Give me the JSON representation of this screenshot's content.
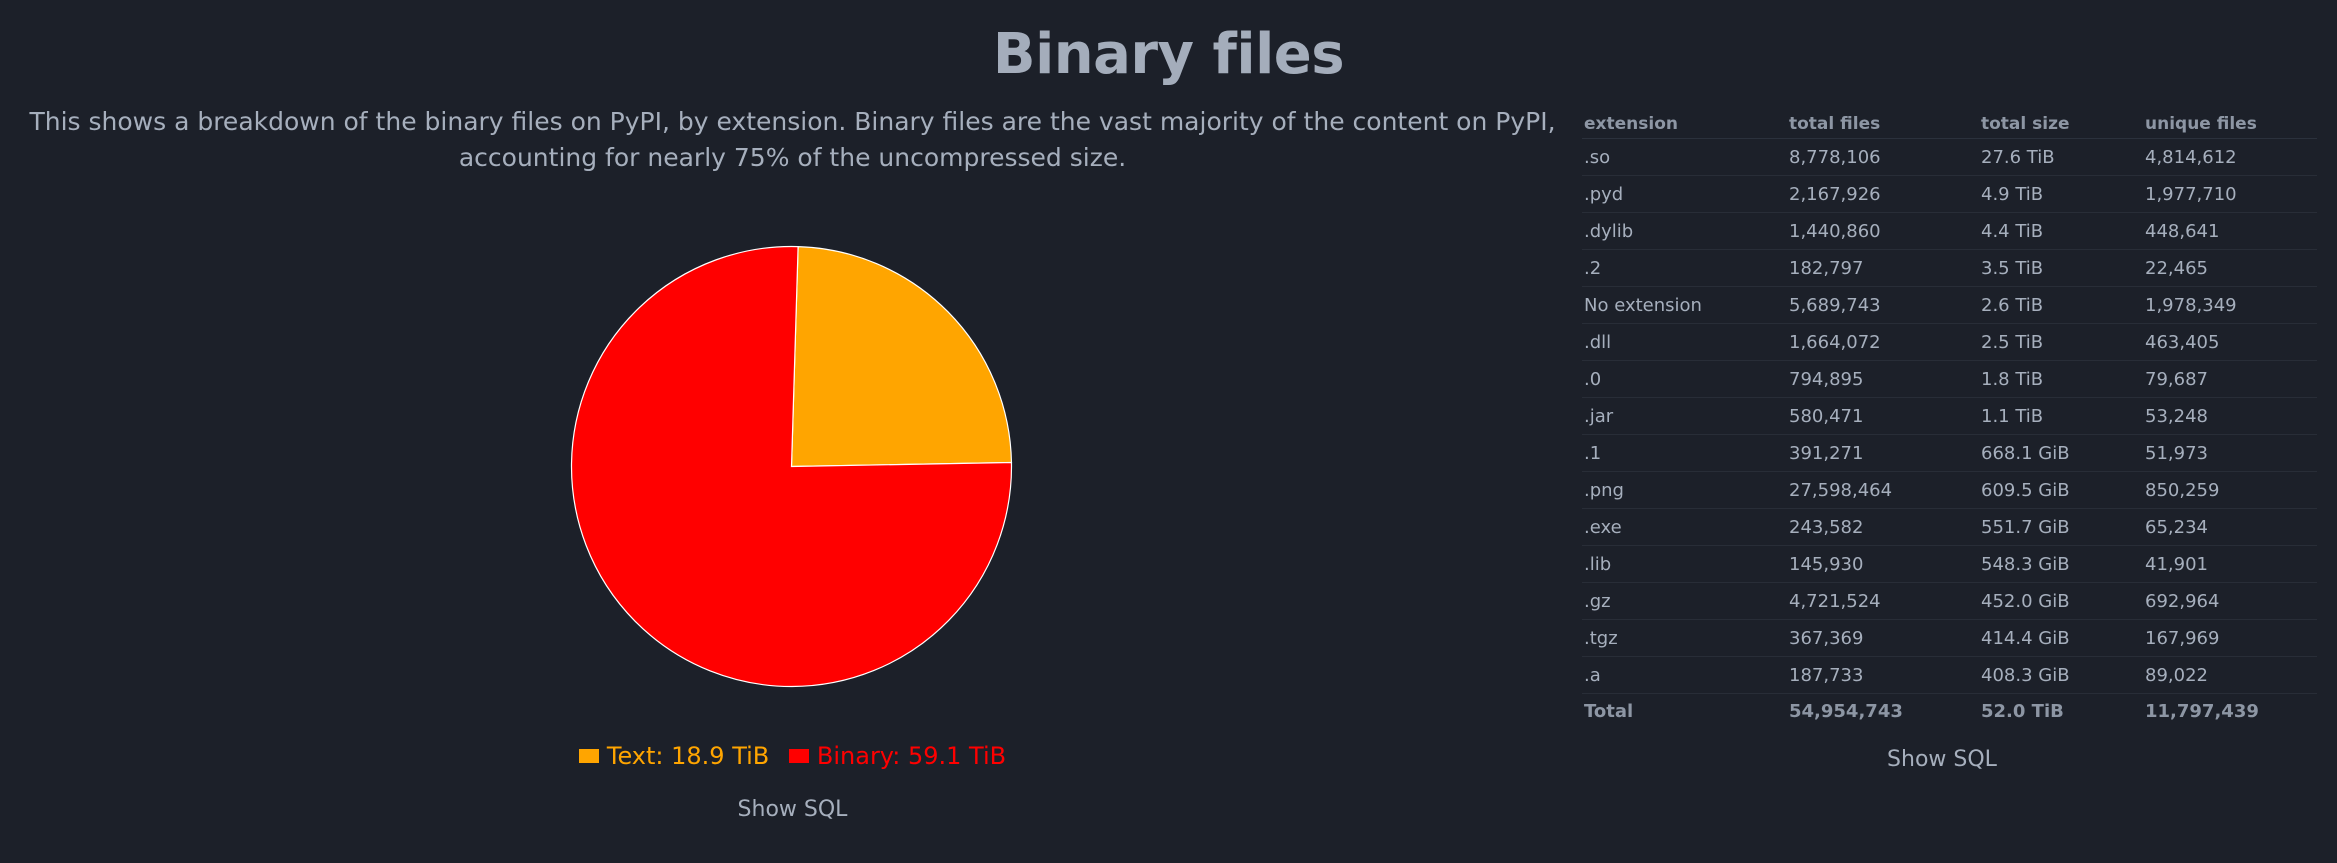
{
  "page": {
    "title": "Binary files",
    "description": "This shows a breakdown of the binary files on PyPI, by extension. Binary files are the vast majority of the content on PyPI, accounting for nearly 75% of the uncompressed size.",
    "show_sql_left": "Show SQL",
    "show_sql_right": "Show SQL"
  },
  "colors": {
    "text_slice": "#ffa500",
    "binary_slice": "#ff0000",
    "background": "#1c2029"
  },
  "chart_data": {
    "type": "pie",
    "title": "",
    "slices": [
      {
        "label": "Text: 18.9 TiB",
        "name": "Text",
        "value": 18.9,
        "unit": "TiB",
        "color": "#ffa500"
      },
      {
        "label": "Binary: 59.1 TiB",
        "name": "Binary",
        "value": 59.1,
        "unit": "TiB",
        "color": "#ff0000"
      }
    ],
    "legend": "bottom"
  },
  "table": {
    "headers": [
      "extension",
      "total files",
      "total size",
      "unique files"
    ],
    "rows": [
      [
        ".so",
        "8,778,106",
        "27.6 TiB",
        "4,814,612"
      ],
      [
        ".pyd",
        "2,167,926",
        "4.9 TiB",
        "1,977,710"
      ],
      [
        ".dylib",
        "1,440,860",
        "4.4 TiB",
        "448,641"
      ],
      [
        ".2",
        "182,797",
        "3.5 TiB",
        "22,465"
      ],
      [
        "No extension",
        "5,689,743",
        "2.6 TiB",
        "1,978,349"
      ],
      [
        ".dll",
        "1,664,072",
        "2.5 TiB",
        "463,405"
      ],
      [
        ".0",
        "794,895",
        "1.8 TiB",
        "79,687"
      ],
      [
        ".jar",
        "580,471",
        "1.1 TiB",
        "53,248"
      ],
      [
        ".1",
        "391,271",
        "668.1 GiB",
        "51,973"
      ],
      [
        ".png",
        "27,598,464",
        "609.5 GiB",
        "850,259"
      ],
      [
        ".exe",
        "243,582",
        "551.7 GiB",
        "65,234"
      ],
      [
        ".lib",
        "145,930",
        "548.3 GiB",
        "41,901"
      ],
      [
        ".gz",
        "4,721,524",
        "452.0 GiB",
        "692,964"
      ],
      [
        ".tgz",
        "367,369",
        "414.4 GiB",
        "167,969"
      ],
      [
        ".a",
        "187,733",
        "408.3 GiB",
        "89,022"
      ]
    ],
    "total": [
      "Total",
      "54,954,743",
      "52.0 TiB",
      "11,797,439"
    ]
  }
}
